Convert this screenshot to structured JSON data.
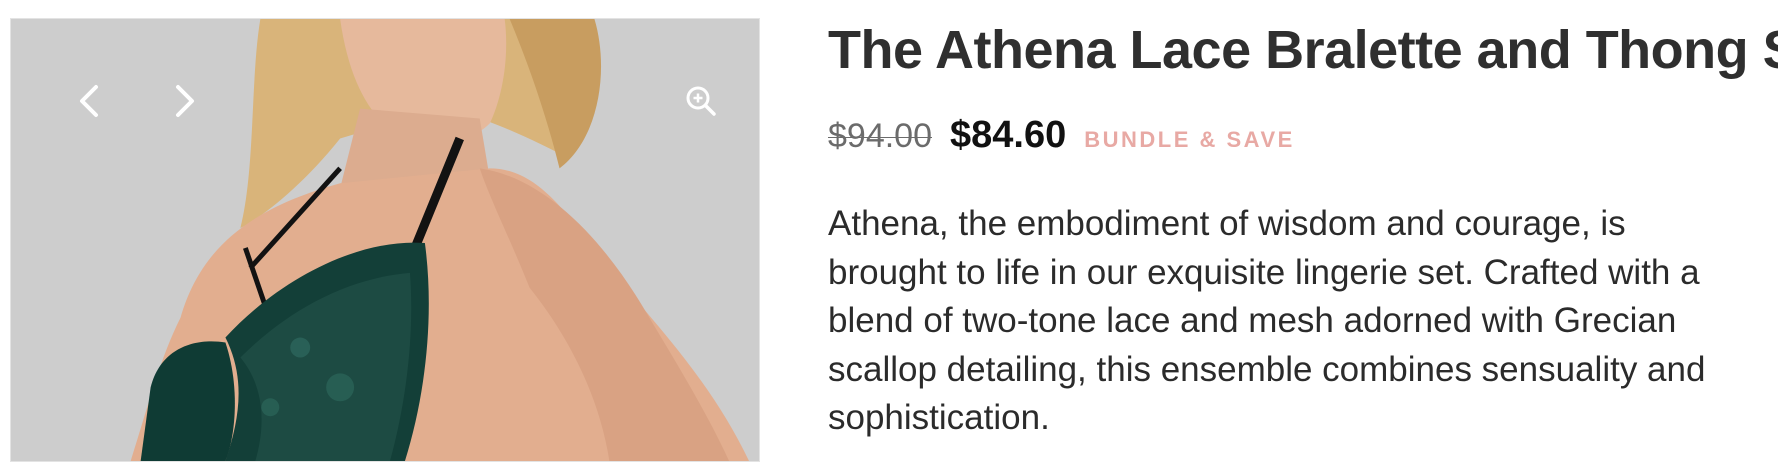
{
  "product": {
    "title": "The Athena Lace Bralette and Thong Set",
    "price_original": "$94.00",
    "price_sale": "$84.60",
    "badge": "BUNDLE & SAVE",
    "description": "Athena, the embodiment of wisdom and courage, is brought to life in our exquisite lingerie set. Crafted with a blend of two-tone lace and mesh adorned with Grecian scallop detailing, this ensemble combines sensuality and sophistication."
  },
  "gallery": {
    "prev_icon": "chevron-left-icon",
    "next_icon": "chevron-right-icon",
    "zoom_icon": "zoom-in-icon"
  },
  "colors": {
    "badge": "#e8a9a4",
    "gallery_bg": "#cdcdcd",
    "lace": "#0f3b34"
  }
}
